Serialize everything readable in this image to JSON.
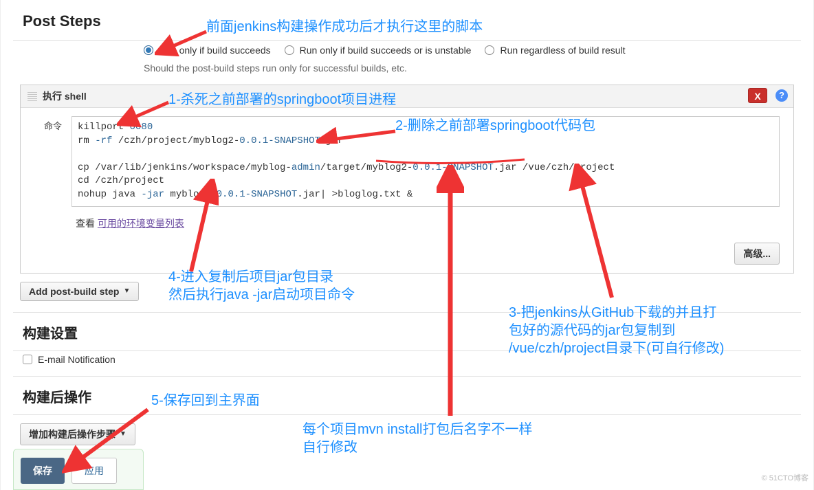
{
  "sections": {
    "post_steps_title": "Post Steps",
    "build_settings_title": "构建设置",
    "post_build_actions_title": "构建后操作"
  },
  "radios": {
    "opt1": "Run only if build succeeds",
    "opt2": "Run only if build succeeds or is unstable",
    "opt3": "Run regardless of build result"
  },
  "hint": "Should the post-build steps run only for successful builds, etc.",
  "shell": {
    "header": "执行 shell",
    "cmd_label": "命令",
    "code_lines": {
      "l1a": "killport ",
      "l1b": "0080",
      "l2a": "rm ",
      "l2b": "-rf",
      "l2c": " /czh/project/myblog2-",
      "l2d": "0.0.1-SNAPSHOT",
      "l2e": ".jar",
      "l3a": "cp /var/lib/jenkins/workspace/myblog-",
      "l3b": "admin",
      "l3c": "/target/myblog2-",
      "l3d": "0.0.1-SNAPSHOT",
      "l3e": ".jar /vue/czh/project",
      "l4": "cd /czh/project",
      "l5a": "nohup java ",
      "l5b": "-jar",
      "l5c": " myblog2-",
      "l5d": "0.0.1-SNAPSHOT",
      "l5e": ".jar| >bloglog.txt &"
    },
    "footer_prefix": "查看 ",
    "footer_link": "可用的环境变量列表",
    "advanced_btn": "高级...",
    "close_btn": "X",
    "help": "?"
  },
  "buttons": {
    "add_post_step": "Add post-build step",
    "add_post_action": "增加构建后操作步骤",
    "save": "保存",
    "apply": "应用"
  },
  "email_label": "E-mail Notification",
  "annotations": {
    "top": "前面jenkins构建操作成功后才执行这里的脚本",
    "a1": "1-杀死之前部署的springboot项目进程",
    "a2": "2-删除之前部署springboot代码包",
    "a4l1": "4-进入复制后项目jar包目录",
    "a4l2": "然后执行java -jar启动项目命令",
    "a3l1": "3-把jenkins从GitHub下载的并且打",
    "a3l2": "包好的源代码的jar包复制到",
    "a3l3": "/vue/czh/project目录下(可自行修改)",
    "a5": "5-保存回到主界面",
    "a6l1": "每个项目mvn install打包后名字不一样",
    "a6l2": "自行修改"
  },
  "watermark": "© 51CTO博客"
}
